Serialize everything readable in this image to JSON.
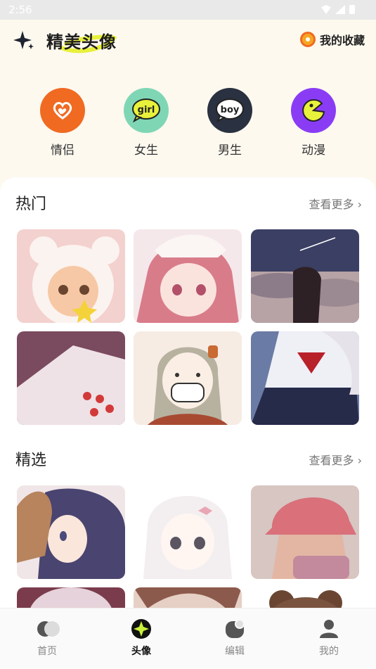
{
  "status_bar": {
    "time": "2:56"
  },
  "header": {
    "title": "精美头像",
    "favorites_label": "我的收藏",
    "highlight_color": "#e8f03c"
  },
  "categories": [
    {
      "label": "情侣",
      "icon": "heart-couple-icon",
      "color": "#f06a22"
    },
    {
      "label": "女生",
      "icon": "girl-badge-icon",
      "color": "#7fd6b5"
    },
    {
      "label": "男生",
      "icon": "boy-badge-icon",
      "color": "#2a3140"
    },
    {
      "label": "动漫",
      "icon": "pacman-icon",
      "color": "#8a3cf5"
    }
  ],
  "sections": {
    "hot": {
      "title": "热门",
      "more": "查看更多"
    },
    "featured": {
      "title": "精选",
      "more": "查看更多"
    }
  },
  "tabs": [
    {
      "label": "首页",
      "icon": "home-icon",
      "active": false
    },
    {
      "label": "头像",
      "icon": "avatar-sparkle-icon",
      "active": true
    },
    {
      "label": "编辑",
      "icon": "edit-icon",
      "active": false
    },
    {
      "label": "我的",
      "icon": "profile-icon",
      "active": false
    }
  ],
  "colors": {
    "background": "#fdf9ef",
    "card": "#ffffff",
    "active_tab": "#111111",
    "inactive_tab": "#888888"
  }
}
